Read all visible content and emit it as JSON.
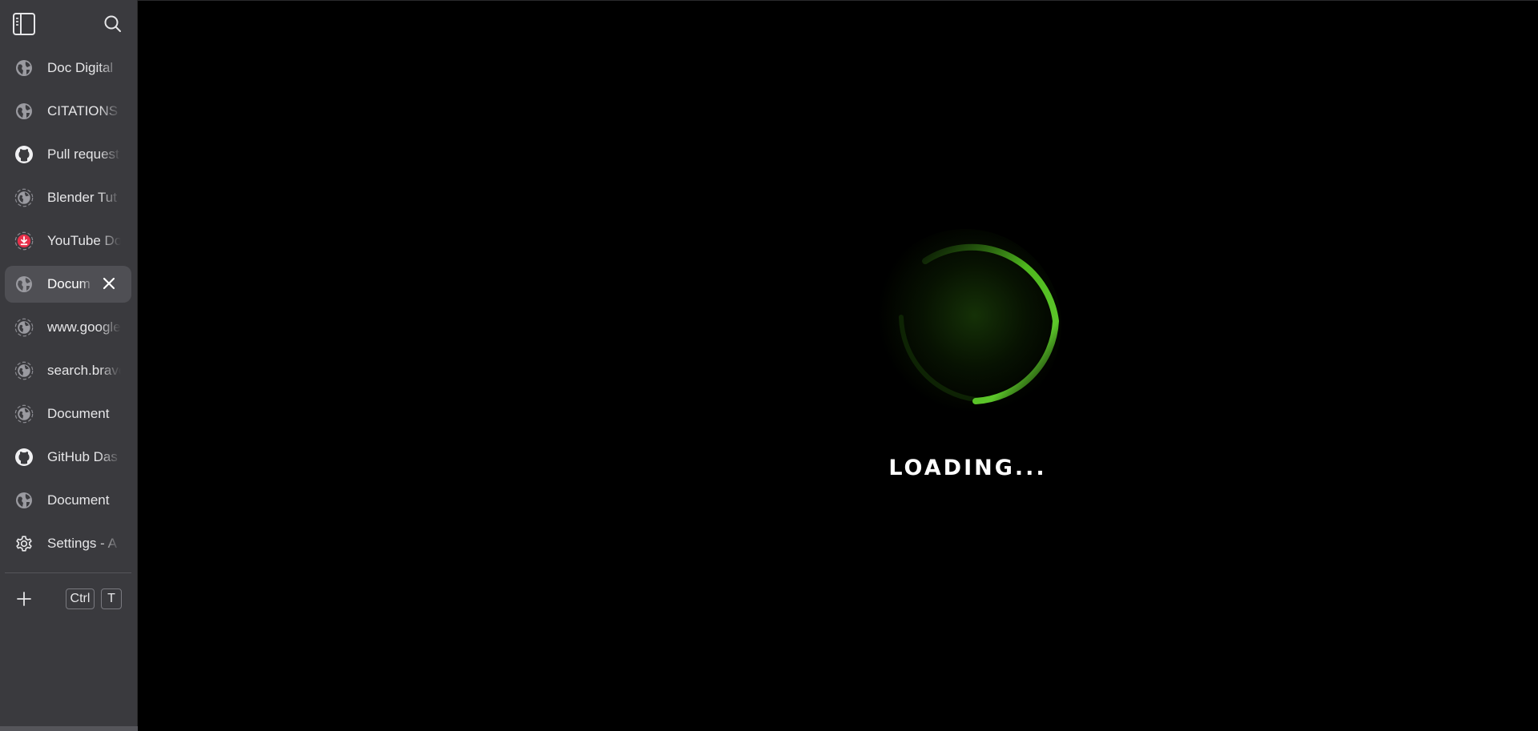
{
  "sidebar": {
    "toggle_icon": "sidebar-toggle-icon",
    "search_icon": "search-icon",
    "tabs": [
      {
        "label": "Doc Digital",
        "icon": "globe-icon"
      },
      {
        "label": "CITATIONS",
        "icon": "globe-icon"
      },
      {
        "label": "Pull request",
        "icon": "github-icon"
      },
      {
        "label": "Blender Tut",
        "icon": "globe-loading-icon"
      },
      {
        "label": "YouTube Do",
        "icon": "download-icon"
      },
      {
        "label": "Docum",
        "icon": "globe-icon",
        "active": true
      },
      {
        "label": "www.google",
        "icon": "globe-loading-icon"
      },
      {
        "label": "search.brave",
        "icon": "globe-loading-icon"
      },
      {
        "label": "Document",
        "icon": "globe-loading-icon"
      },
      {
        "label": "GitHub Das",
        "icon": "github-icon"
      },
      {
        "label": "Document",
        "icon": "globe-icon"
      },
      {
        "label": "Settings - A",
        "icon": "gear-icon"
      }
    ],
    "new_tab": {
      "icon": "plus-icon",
      "shortcut_key1": "Ctrl",
      "shortcut_key2": "T"
    }
  },
  "main": {
    "loading_text": "LOADING...",
    "accent_color": "#5cc62a"
  }
}
